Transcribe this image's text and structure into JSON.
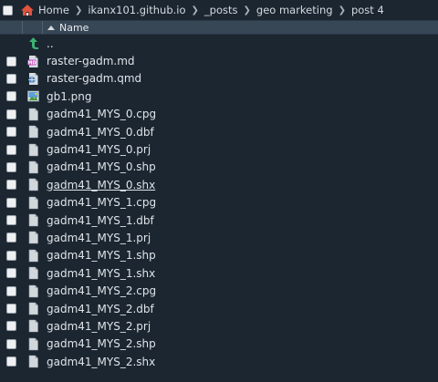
{
  "breadcrumb": [
    "Home",
    "ikanx101.github.io",
    "_posts",
    "geo marketing",
    "post 4"
  ],
  "header": {
    "name_label": "Name"
  },
  "parent_label": "..",
  "files": [
    {
      "name": "raster-gadm.md",
      "icon": "markdown-file-icon"
    },
    {
      "name": "raster-gadm.qmd",
      "icon": "quarto-file-icon"
    },
    {
      "name": "gb1.png",
      "icon": "image-file-icon"
    },
    {
      "name": "gadm41_MYS_0.cpg",
      "icon": "generic-file-icon"
    },
    {
      "name": "gadm41_MYS_0.dbf",
      "icon": "generic-file-icon"
    },
    {
      "name": "gadm41_MYS_0.prj",
      "icon": "generic-file-icon"
    },
    {
      "name": "gadm41_MYS_0.shp",
      "icon": "generic-file-icon"
    },
    {
      "name": "gadm41_MYS_0.shx",
      "icon": "generic-file-icon",
      "underlined": true
    },
    {
      "name": "gadm41_MYS_1.cpg",
      "icon": "generic-file-icon"
    },
    {
      "name": "gadm41_MYS_1.dbf",
      "icon": "generic-file-icon"
    },
    {
      "name": "gadm41_MYS_1.prj",
      "icon": "generic-file-icon"
    },
    {
      "name": "gadm41_MYS_1.shp",
      "icon": "generic-file-icon"
    },
    {
      "name": "gadm41_MYS_1.shx",
      "icon": "generic-file-icon"
    },
    {
      "name": "gadm41_MYS_2.cpg",
      "icon": "generic-file-icon"
    },
    {
      "name": "gadm41_MYS_2.dbf",
      "icon": "generic-file-icon"
    },
    {
      "name": "gadm41_MYS_2.prj",
      "icon": "generic-file-icon"
    },
    {
      "name": "gadm41_MYS_2.shp",
      "icon": "generic-file-icon"
    },
    {
      "name": "gadm41_MYS_2.shx",
      "icon": "generic-file-icon"
    }
  ],
  "colors": {
    "background": "#1b2631",
    "header": "#384756",
    "home": "#e0533d",
    "up_arrow": "#3cb371"
  }
}
